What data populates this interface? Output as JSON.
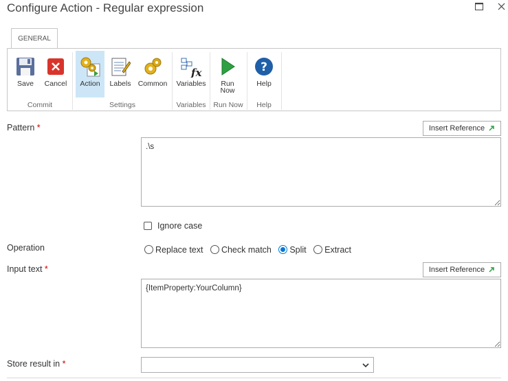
{
  "window": {
    "title": "Configure Action - Regular expression"
  },
  "ribbon": {
    "tab": "GENERAL",
    "buttons": {
      "save": "Save",
      "cancel": "Cancel",
      "action": "Action",
      "labels": "Labels",
      "common": "Common",
      "variables": "Variables",
      "run_now_line1": "Run",
      "run_now_line2": "Now",
      "help": "Help"
    },
    "groups": {
      "commit": "Commit",
      "settings": "Settings",
      "variables": "Variables",
      "run_now": "Run Now",
      "help": "Help"
    }
  },
  "form": {
    "pattern": {
      "label": "Pattern",
      "required": "*",
      "value": ".\\s",
      "insert_reference": "Insert Reference"
    },
    "ignore_case": {
      "label": "Ignore case",
      "checked": false
    },
    "operation": {
      "label": "Operation",
      "options": [
        "Replace text",
        "Check match",
        "Split",
        "Extract"
      ],
      "selected": "Split"
    },
    "input_text": {
      "label": "Input text",
      "required": "*",
      "value": "{ItemProperty:YourColumn}",
      "insert_reference": "Insert Reference"
    },
    "store_result": {
      "label": "Store result in",
      "required": "*",
      "value": ""
    }
  },
  "colors": {
    "accent": "#0078d4",
    "required": "#cc0000",
    "selected_ribbon": "#cde6f7"
  }
}
